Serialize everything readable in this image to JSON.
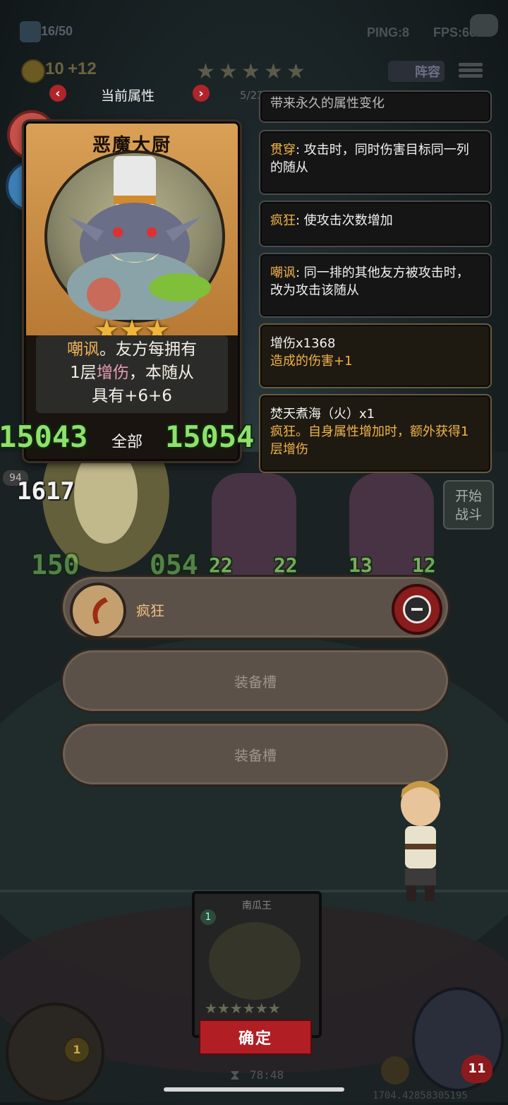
{
  "hud": {
    "player_count": "16/50",
    "ping": "PING:8",
    "fps": "FPS:60",
    "gold": "10",
    "gold_gain": "+12",
    "lineup_label": "阵容"
  },
  "attr_nav": {
    "title": "当前属性",
    "page": "5/23"
  },
  "card": {
    "name": "恶魔大厨",
    "stars": 3,
    "desc_parts": [
      "嘲讽",
      "。友方每拥有",
      "1层",
      "增伤",
      "，本随从",
      "具有+6+6"
    ],
    "stat_left": "15043",
    "stat_right": "15054",
    "filter_label": "全部"
  },
  "side_stat": {
    "value": "1617",
    "small": "94"
  },
  "panels": [
    {
      "keyword": "",
      "text": "带来永久的属性变化"
    },
    {
      "keyword": "贯穿",
      "text": ": 攻击时，同时伤害目标同一列的随从"
    },
    {
      "keyword": "疯狂",
      "text": ": 使攻击次数增加"
    },
    {
      "keyword": "嘲讽",
      "text": ": 同一排的其他友方被攻击时，改为攻击该随从"
    },
    {
      "line1": "增伤x1368",
      "line2": "造成的伤害+1"
    },
    {
      "line1": "焚天煮海（火）x1",
      "line2": "疯狂。自身属性增加时，额外获得1层增伤"
    }
  ],
  "board": {
    "start_battle": "开始战斗",
    "stat_a": "22",
    "stat_b": "22",
    "stat_c": "13",
    "stat_d": "12",
    "faded_left": "150",
    "faded_right": "054"
  },
  "equipment": {
    "slot1_label": "疯狂",
    "slot2_label": "装备槽",
    "slot3_label": "装备槽"
  },
  "bottom": {
    "mini_card_name": "南瓜王",
    "mini_card_level": "1",
    "confirm_label": "确定",
    "timer": "78:48",
    "left_badge": "1",
    "right_badge": "11",
    "footer_number": "1704.42858305195"
  },
  "colors": {
    "accent_gold": "#f1b24a",
    "stat_green": "#8fe06c",
    "confirm_red": "#b11e24"
  }
}
